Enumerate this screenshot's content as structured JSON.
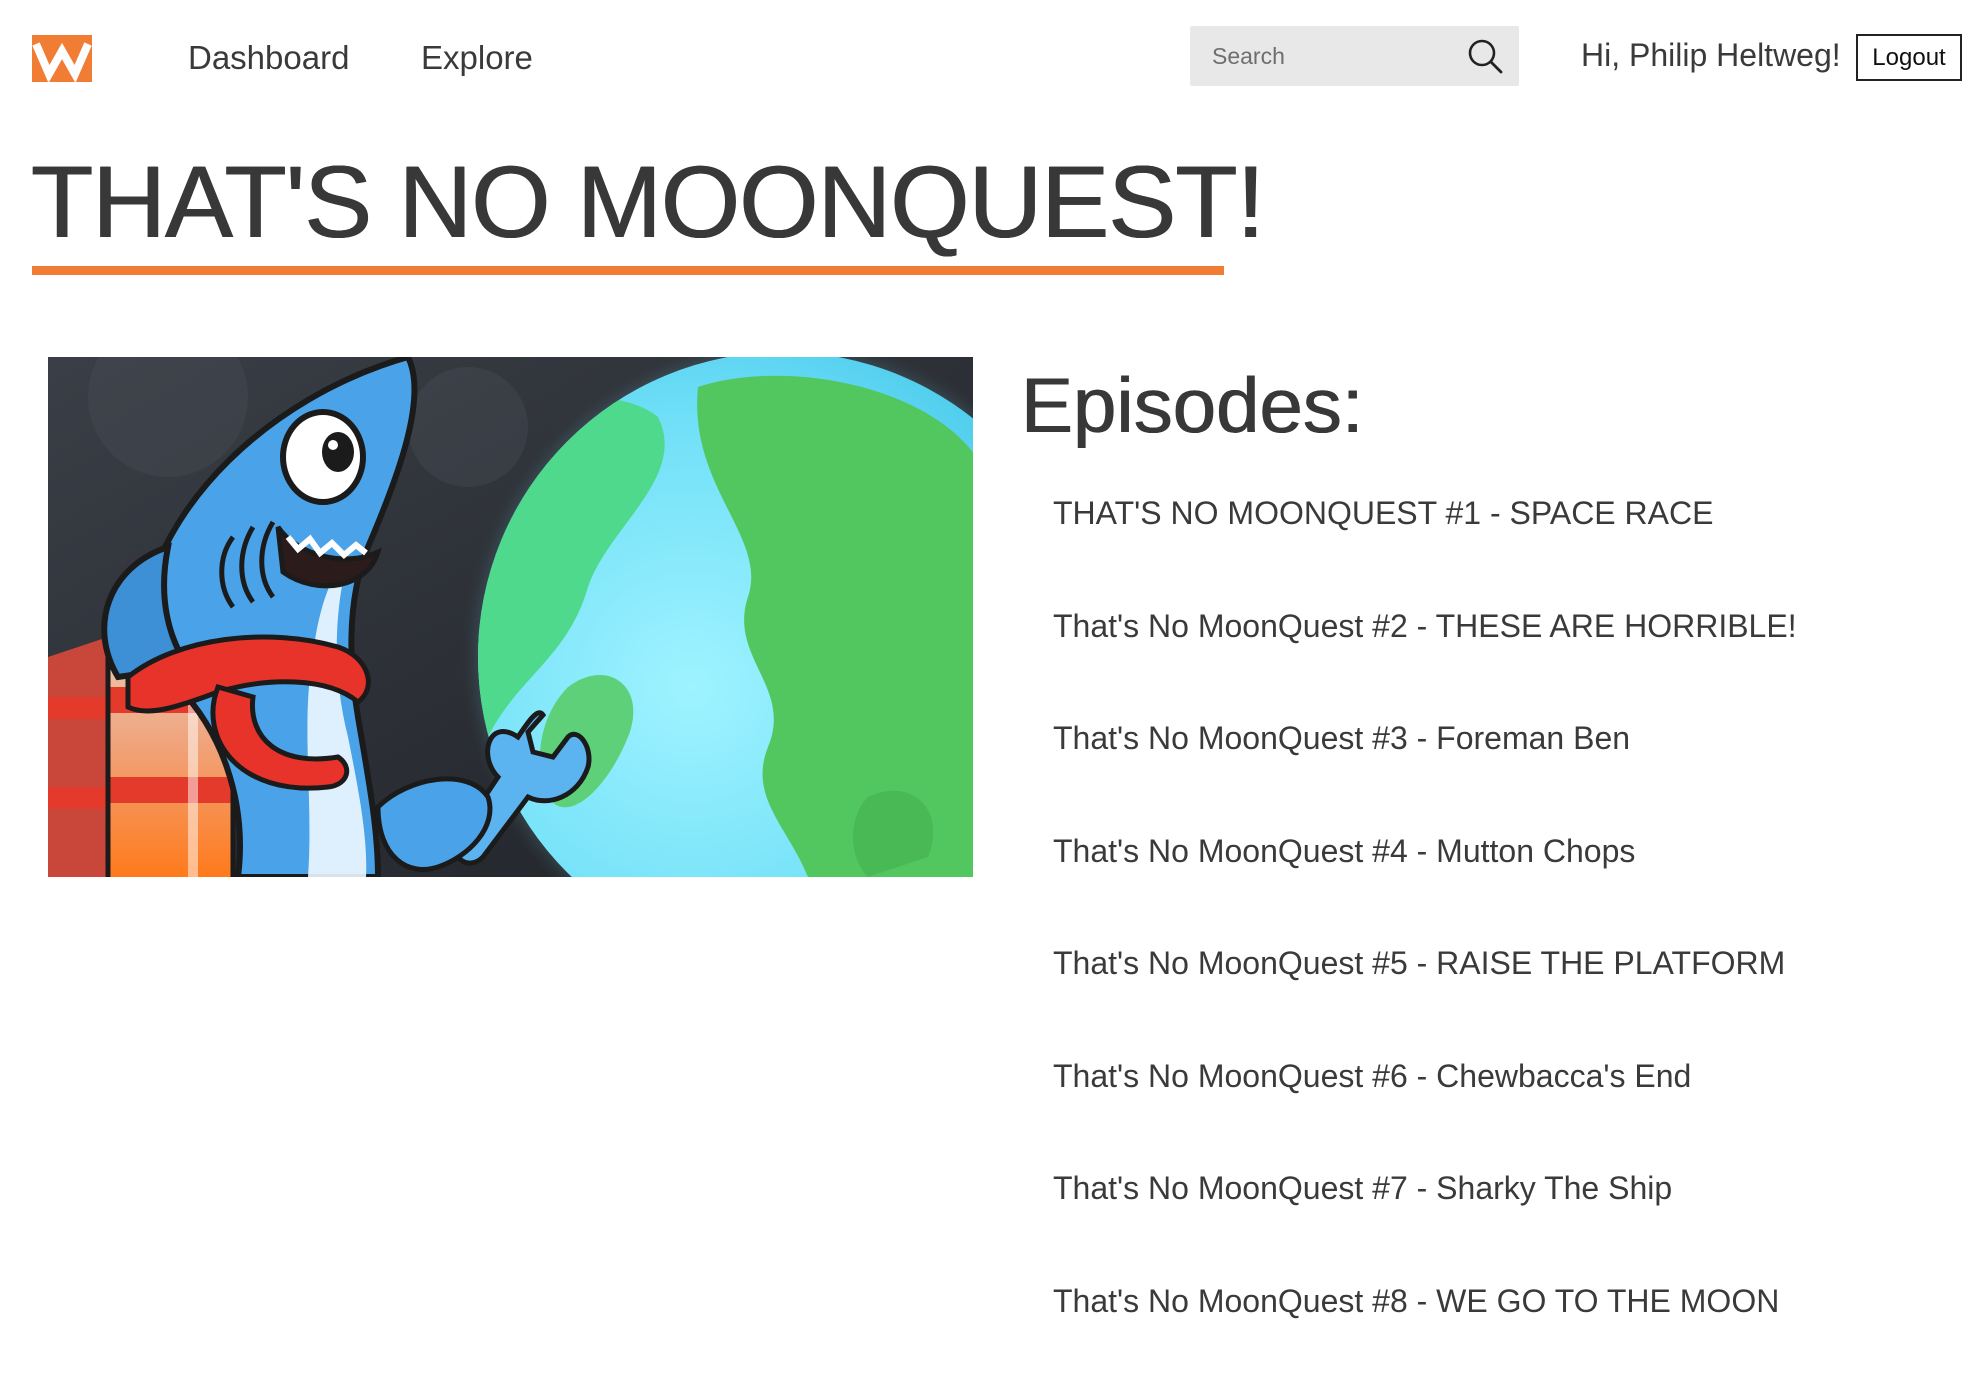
{
  "nav": {
    "logo_icon": "w-logo-icon",
    "brand_color": "#f07d33",
    "links": [
      {
        "label": "Dashboard"
      },
      {
        "label": "Explore"
      }
    ]
  },
  "search": {
    "placeholder": "Search",
    "value": "",
    "icon": "search-icon"
  },
  "user": {
    "greeting": "Hi, Philip Heltweg!",
    "logout_label": "Logout"
  },
  "page": {
    "title": "THAT'S NO MOONQUEST!",
    "underline_color": "#f07d33",
    "cover_image": "shark-astronaut-earth-cover"
  },
  "episodes": {
    "heading": "Episodes:",
    "items": [
      {
        "title": "THAT'S NO MOONQUEST #1 - SPACE RACE"
      },
      {
        "title": "That's No MoonQuest #2 - THESE ARE HORRIBLE!"
      },
      {
        "title": "That's No MoonQuest #3 - Foreman Ben"
      },
      {
        "title": "That's No MoonQuest #4 - Mutton Chops"
      },
      {
        "title": "That's No MoonQuest #5 - RAISE THE PLATFORM"
      },
      {
        "title": "That's No MoonQuest #6 - Chewbacca's End"
      },
      {
        "title": "That's No MoonQuest #7 - Sharky The Ship"
      },
      {
        "title": "That's No MoonQuest #8 - WE GO TO THE MOON"
      }
    ]
  }
}
